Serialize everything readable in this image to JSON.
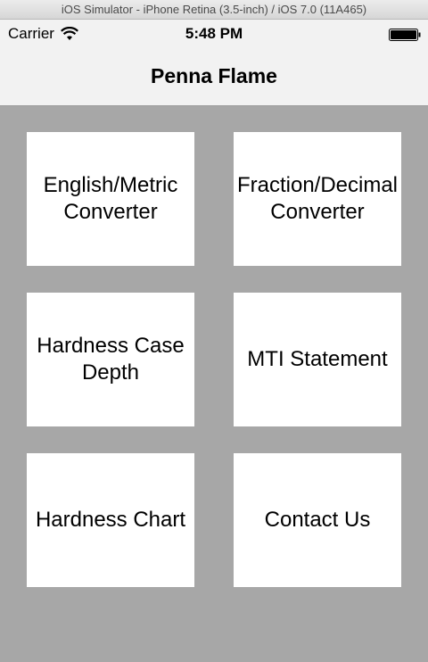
{
  "simulator": {
    "title": "iOS Simulator - iPhone Retina (3.5-inch) / iOS 7.0 (11A465)"
  },
  "status_bar": {
    "carrier": "Carrier",
    "time": "5:48 PM",
    "wifi_icon": "wifi-icon",
    "battery_icon": "battery-icon"
  },
  "nav": {
    "title": "Penna Flame"
  },
  "menu": {
    "english_metric": "English/Metric\nConverter",
    "fraction_decimal": "Fraction/Decimal\nConverter",
    "hardness_case_depth": "Hardness Case\nDepth",
    "mti_statement": "MTI Statement",
    "hardness_chart": "Hardness Chart",
    "contact_us": "Contact Us"
  },
  "colors": {
    "background": "#a7a7a7",
    "tile": "#ffffff",
    "bar": "#f2f2f2"
  }
}
